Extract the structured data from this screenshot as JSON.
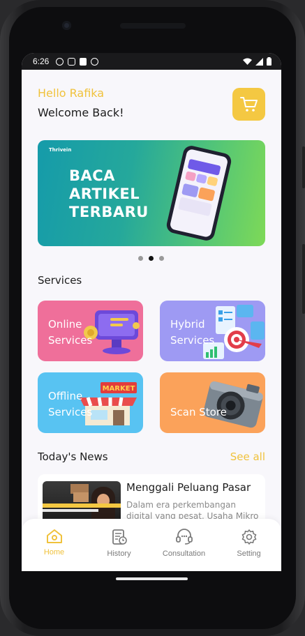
{
  "status_bar": {
    "time": "6:26"
  },
  "header": {
    "greeting": "Hello Rafika",
    "subtitle": "Welcome Back!"
  },
  "banner": {
    "brand": "Thrivein",
    "headline": "BACA\nARTIKEL\nTERBARU"
  },
  "carousel": {
    "total": 3,
    "active_index": 1
  },
  "services": {
    "title": "Services",
    "items": [
      {
        "label": "Online\nServices",
        "color": "#ef6f9a"
      },
      {
        "label": "Hybrid\nServices",
        "color": "#9e9af3"
      },
      {
        "label": "Offline\nServices",
        "color": "#58c3f2"
      },
      {
        "label": "Scan Store",
        "color": "#fba25a"
      }
    ]
  },
  "news": {
    "title": "Today's News",
    "see_all": "See all",
    "items": [
      {
        "headline": "Menggali Peluang Pasar",
        "excerpt": "Dalam era perkembangan digital yang pesat, Usaha Mikro"
      }
    ]
  },
  "nav": {
    "items": [
      {
        "label": "Home",
        "icon": "home-icon",
        "active": true
      },
      {
        "label": "History",
        "icon": "history-icon"
      },
      {
        "label": "Consultation",
        "icon": "consultation-icon"
      },
      {
        "label": "Setting",
        "icon": "setting-icon"
      }
    ]
  },
  "colors": {
    "accent": "#f4c842",
    "accent_text": "#f0c23c",
    "background": "#f8f7fb"
  }
}
